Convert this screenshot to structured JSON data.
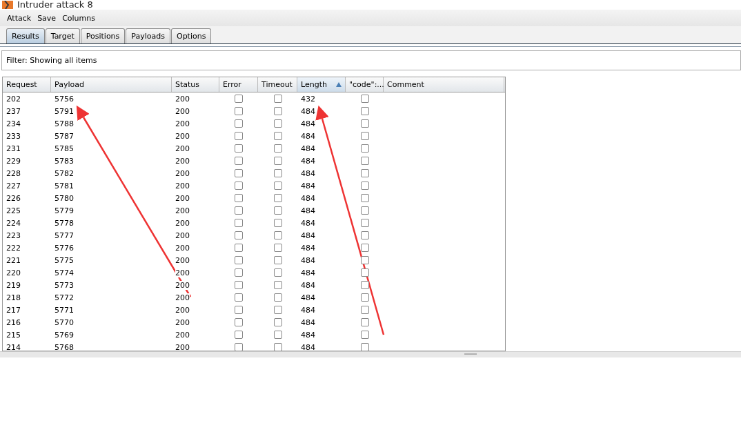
{
  "window": {
    "title": "Intruder attack 8"
  },
  "menu": [
    "Attack",
    "Save",
    "Columns"
  ],
  "tabs": [
    {
      "label": "Results",
      "selected": true
    },
    {
      "label": "Target",
      "selected": false
    },
    {
      "label": "Positions",
      "selected": false
    },
    {
      "label": "Payloads",
      "selected": false
    },
    {
      "label": "Options",
      "selected": false
    }
  ],
  "filter": "Filter:  Showing all items",
  "table": {
    "columns": [
      {
        "label": "Request",
        "sorted": false
      },
      {
        "label": "Payload",
        "sorted": false
      },
      {
        "label": "Status",
        "sorted": false
      },
      {
        "label": "Error",
        "sorted": false
      },
      {
        "label": "Timeout",
        "sorted": false
      },
      {
        "label": "Length",
        "sorted": true
      },
      {
        "label": "\"code\":...",
        "sorted": false
      },
      {
        "label": "Comment",
        "sorted": false
      }
    ],
    "rows": [
      {
        "request": "202",
        "payload": "5756",
        "status": "200",
        "error": false,
        "timeout": false,
        "length": "432",
        "code": false
      },
      {
        "request": "237",
        "payload": "5791",
        "status": "200",
        "error": false,
        "timeout": false,
        "length": "484",
        "code": false
      },
      {
        "request": "234",
        "payload": "5788",
        "status": "200",
        "error": false,
        "timeout": false,
        "length": "484",
        "code": false
      },
      {
        "request": "233",
        "payload": "5787",
        "status": "200",
        "error": false,
        "timeout": false,
        "length": "484",
        "code": false
      },
      {
        "request": "231",
        "payload": "5785",
        "status": "200",
        "error": false,
        "timeout": false,
        "length": "484",
        "code": false
      },
      {
        "request": "229",
        "payload": "5783",
        "status": "200",
        "error": false,
        "timeout": false,
        "length": "484",
        "code": false
      },
      {
        "request": "228",
        "payload": "5782",
        "status": "200",
        "error": false,
        "timeout": false,
        "length": "484",
        "code": false
      },
      {
        "request": "227",
        "payload": "5781",
        "status": "200",
        "error": false,
        "timeout": false,
        "length": "484",
        "code": false
      },
      {
        "request": "226",
        "payload": "5780",
        "status": "200",
        "error": false,
        "timeout": false,
        "length": "484",
        "code": false
      },
      {
        "request": "225",
        "payload": "5779",
        "status": "200",
        "error": false,
        "timeout": false,
        "length": "484",
        "code": false
      },
      {
        "request": "224",
        "payload": "5778",
        "status": "200",
        "error": false,
        "timeout": false,
        "length": "484",
        "code": false
      },
      {
        "request": "223",
        "payload": "5777",
        "status": "200",
        "error": false,
        "timeout": false,
        "length": "484",
        "code": false
      },
      {
        "request": "222",
        "payload": "5776",
        "status": "200",
        "error": false,
        "timeout": false,
        "length": "484",
        "code": false
      },
      {
        "request": "221",
        "payload": "5775",
        "status": "200",
        "error": false,
        "timeout": false,
        "length": "484",
        "code": false
      },
      {
        "request": "220",
        "payload": "5774",
        "status": "200",
        "error": false,
        "timeout": false,
        "length": "484",
        "code": false
      },
      {
        "request": "219",
        "payload": "5773",
        "status": "200",
        "error": false,
        "timeout": false,
        "length": "484",
        "code": false
      },
      {
        "request": "218",
        "payload": "5772",
        "status": "200",
        "error": false,
        "timeout": false,
        "length": "484",
        "code": false
      },
      {
        "request": "217",
        "payload": "5771",
        "status": "200",
        "error": false,
        "timeout": false,
        "length": "484",
        "code": false
      },
      {
        "request": "216",
        "payload": "5770",
        "status": "200",
        "error": false,
        "timeout": false,
        "length": "484",
        "code": false
      },
      {
        "request": "215",
        "payload": "5769",
        "status": "200",
        "error": false,
        "timeout": false,
        "length": "484",
        "code": false
      },
      {
        "request": "214",
        "payload": "5768",
        "status": "200",
        "error": false,
        "timeout": false,
        "length": "484",
        "code": false
      }
    ]
  }
}
